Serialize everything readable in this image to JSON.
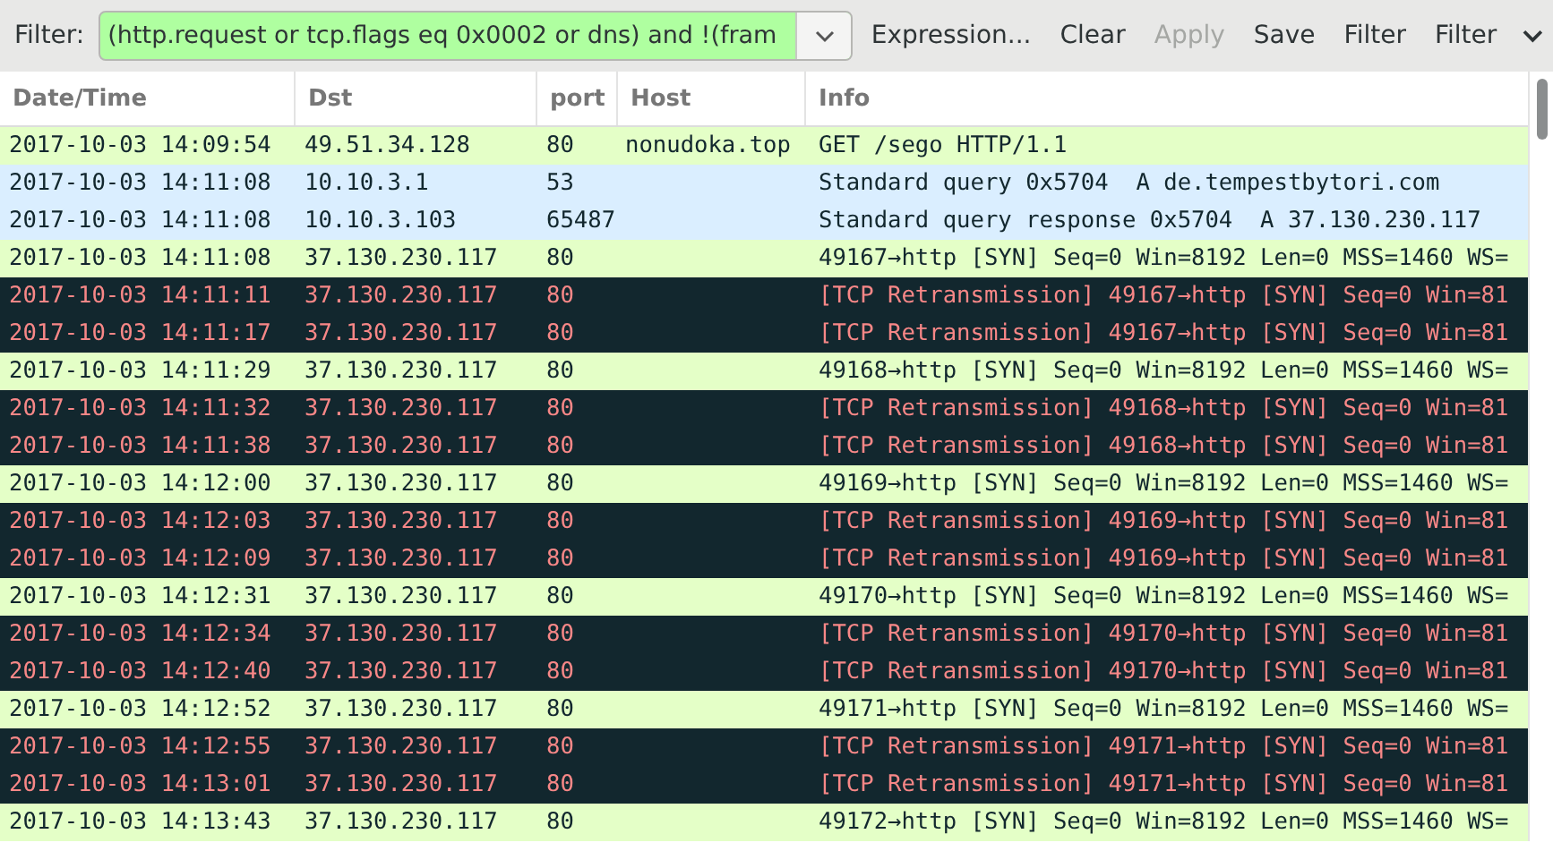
{
  "toolbar": {
    "filter_label": "Filter:",
    "filter_value": "(http.request or tcp.flags eq 0x0002 or dns) and !(fram",
    "buttons": [
      {
        "label": "Expression...",
        "disabled": false
      },
      {
        "label": "Clear",
        "disabled": false
      },
      {
        "label": "Apply",
        "disabled": true
      },
      {
        "label": "Save",
        "disabled": false
      },
      {
        "label": "Filter",
        "disabled": false
      },
      {
        "label": "Filter",
        "disabled": false
      }
    ]
  },
  "table": {
    "columns": [
      "Date/Time",
      "Dst",
      "port",
      "Host",
      "Info"
    ],
    "rows": [
      {
        "kind": "http",
        "cells": [
          "2017-10-03 14:09:54",
          "49.51.34.128",
          "80",
          "nonudoka.top",
          "GET /sego HTTP/1.1"
        ]
      },
      {
        "kind": "dns",
        "cells": [
          "2017-10-03 14:11:08",
          "10.10.3.1",
          "53",
          "",
          "Standard query 0x5704  A de.tempestbytori.com"
        ]
      },
      {
        "kind": "dns",
        "cells": [
          "2017-10-03 14:11:08",
          "10.10.3.103",
          "65487",
          "",
          "Standard query response 0x5704  A 37.130.230.117"
        ]
      },
      {
        "kind": "syn",
        "cells": [
          "2017-10-03 14:11:08",
          "37.130.230.117",
          "80",
          "",
          "49167→http [SYN] Seq=0 Win=8192 Len=0 MSS=1460 WS="
        ]
      },
      {
        "kind": "retransmission",
        "cells": [
          "2017-10-03 14:11:11",
          "37.130.230.117",
          "80",
          "",
          "[TCP Retransmission] 49167→http [SYN] Seq=0 Win=81"
        ]
      },
      {
        "kind": "retransmission",
        "cells": [
          "2017-10-03 14:11:17",
          "37.130.230.117",
          "80",
          "",
          "[TCP Retransmission] 49167→http [SYN] Seq=0 Win=81"
        ]
      },
      {
        "kind": "syn",
        "cells": [
          "2017-10-03 14:11:29",
          "37.130.230.117",
          "80",
          "",
          "49168→http [SYN] Seq=0 Win=8192 Len=0 MSS=1460 WS="
        ]
      },
      {
        "kind": "retransmission",
        "cells": [
          "2017-10-03 14:11:32",
          "37.130.230.117",
          "80",
          "",
          "[TCP Retransmission] 49168→http [SYN] Seq=0 Win=81"
        ]
      },
      {
        "kind": "retransmission",
        "cells": [
          "2017-10-03 14:11:38",
          "37.130.230.117",
          "80",
          "",
          "[TCP Retransmission] 49168→http [SYN] Seq=0 Win=81"
        ]
      },
      {
        "kind": "syn",
        "cells": [
          "2017-10-03 14:12:00",
          "37.130.230.117",
          "80",
          "",
          "49169→http [SYN] Seq=0 Win=8192 Len=0 MSS=1460 WS="
        ]
      },
      {
        "kind": "retransmission",
        "cells": [
          "2017-10-03 14:12:03",
          "37.130.230.117",
          "80",
          "",
          "[TCP Retransmission] 49169→http [SYN] Seq=0 Win=81"
        ]
      },
      {
        "kind": "retransmission",
        "cells": [
          "2017-10-03 14:12:09",
          "37.130.230.117",
          "80",
          "",
          "[TCP Retransmission] 49169→http [SYN] Seq=0 Win=81"
        ]
      },
      {
        "kind": "syn",
        "cells": [
          "2017-10-03 14:12:31",
          "37.130.230.117",
          "80",
          "",
          "49170→http [SYN] Seq=0 Win=8192 Len=0 MSS=1460 WS="
        ]
      },
      {
        "kind": "retransmission",
        "cells": [
          "2017-10-03 14:12:34",
          "37.130.230.117",
          "80",
          "",
          "[TCP Retransmission] 49170→http [SYN] Seq=0 Win=81"
        ]
      },
      {
        "kind": "retransmission",
        "cells": [
          "2017-10-03 14:12:40",
          "37.130.230.117",
          "80",
          "",
          "[TCP Retransmission] 49170→http [SYN] Seq=0 Win=81"
        ]
      },
      {
        "kind": "syn",
        "cells": [
          "2017-10-03 14:12:52",
          "37.130.230.117",
          "80",
          "",
          "49171→http [SYN] Seq=0 Win=8192 Len=0 MSS=1460 WS="
        ]
      },
      {
        "kind": "retransmission",
        "cells": [
          "2017-10-03 14:12:55",
          "37.130.230.117",
          "80",
          "",
          "[TCP Retransmission] 49171→http [SYN] Seq=0 Win=81"
        ]
      },
      {
        "kind": "retransmission",
        "cells": [
          "2017-10-03 14:13:01",
          "37.130.230.117",
          "80",
          "",
          "[TCP Retransmission] 49171→http [SYN] Seq=0 Win=81"
        ]
      },
      {
        "kind": "syn",
        "cells": [
          "2017-10-03 14:13:43",
          "37.130.230.117",
          "80",
          "",
          "49172→http [SYN] Seq=0 Win=8192 Len=0 MSS=1460 WS="
        ]
      }
    ]
  }
}
